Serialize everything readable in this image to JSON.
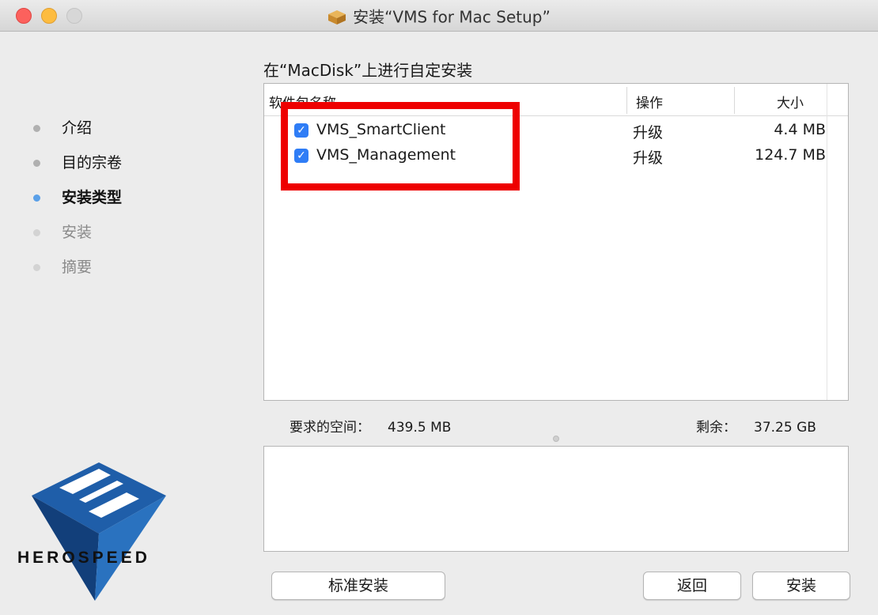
{
  "window": {
    "title": "安装“VMS for Mac Setup”",
    "package_icon": "package-icon"
  },
  "steps": [
    {
      "label": "介绍",
      "state": "done"
    },
    {
      "label": "目的宗卷",
      "state": "done"
    },
    {
      "label": "安装类型",
      "state": "current"
    },
    {
      "label": "安装",
      "state": "future"
    },
    {
      "label": "摘要",
      "state": "future"
    }
  ],
  "logo": {
    "text": "HEROSPEED",
    "color": "#1e5ea8"
  },
  "main": {
    "heading": "在“MacDisk”上进行自定安装",
    "columns": {
      "name": "软件包名称",
      "action": "操作",
      "size": "大小"
    },
    "packages": [
      {
        "checked": true,
        "name": "VMS_SmartClient",
        "action": "升级",
        "size": "4.4 MB"
      },
      {
        "checked": true,
        "name": "VMS_Management",
        "action": "升级",
        "size": "124.7 MB"
      }
    ],
    "space_required_label": "要求的空间：",
    "space_required_value": "439.5 MB",
    "space_remaining_label": "剩余：",
    "space_remaining_value": "37.25 GB"
  },
  "buttons": {
    "standard_install": "标准安装",
    "back": "返回",
    "install": "安装"
  },
  "colors": {
    "highlight": "#ee0000",
    "checkbox": "#2f7df6",
    "current_step": "#5aa0e8"
  }
}
